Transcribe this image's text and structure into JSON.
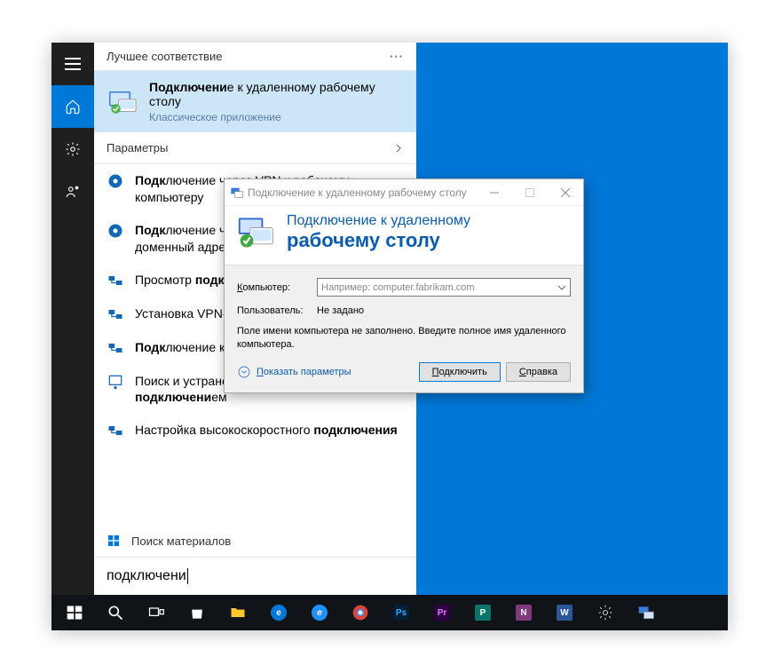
{
  "start_menu": {
    "best_match_header": "Лучшее соответствие",
    "best_match": {
      "title_pre": "Подключени",
      "title_bold_frag": "е",
      "title_post": " к удаленному рабочему столу",
      "subtitle": "Классическое приложение"
    },
    "params_header": "Параметры",
    "results": [
      "Подключение через VPN к рабочему компьютеру",
      "Подключение через универсальный доменный адрес",
      "Просмотр подключений",
      "Установка VPN-подключения",
      "Подключение к удаленному рабочему столу",
      "Поиск и устранение проблем с сетью и подключением",
      "Настройка высокоскоростного подключения"
    ],
    "store_header": "Поиск материалов",
    "search_text": "подключени"
  },
  "rdp_dialog": {
    "window_title": "Подключение к удаленному рабочему столу",
    "header_line1": "Подключение к удаленному",
    "header_line2": "рабочему столу",
    "computer_label": "Компьютер:",
    "computer_placeholder": "Например: computer.fabrikam.com",
    "user_label": "Пользователь:",
    "user_value": "Не задано",
    "message": "Поле имени компьютера не заполнено. Введите полное имя удаленного компьютера.",
    "show_options": "Показать параметры",
    "connect_btn": "Подключить",
    "help_btn": "Справка"
  },
  "taskbar": {
    "apps": [
      {
        "name": "start",
        "label": "",
        "bg": "transparent"
      },
      {
        "name": "search",
        "label": "",
        "bg": "transparent"
      },
      {
        "name": "taskview",
        "label": "",
        "bg": "transparent"
      },
      {
        "name": "store",
        "label": "",
        "bg": "transparent"
      },
      {
        "name": "explorer",
        "label": "",
        "bg": "transparent"
      },
      {
        "name": "edge",
        "label": "e",
        "bg": "#0078d7"
      },
      {
        "name": "ie",
        "label": "e",
        "bg": "#1e90ff"
      },
      {
        "name": "chrome",
        "label": "",
        "bg": "transparent"
      },
      {
        "name": "photoshop",
        "label": "Ps",
        "bg": "#001e36"
      },
      {
        "name": "premiere",
        "label": "Pr",
        "bg": "#2a003f"
      },
      {
        "name": "publisher",
        "label": "P",
        "bg": "#077568"
      },
      {
        "name": "onenote",
        "label": "N",
        "bg": "#80397b"
      },
      {
        "name": "word",
        "label": "W",
        "bg": "#2b579a"
      },
      {
        "name": "settings",
        "label": "",
        "bg": "transparent"
      },
      {
        "name": "rdp",
        "label": "",
        "bg": "transparent"
      }
    ]
  }
}
